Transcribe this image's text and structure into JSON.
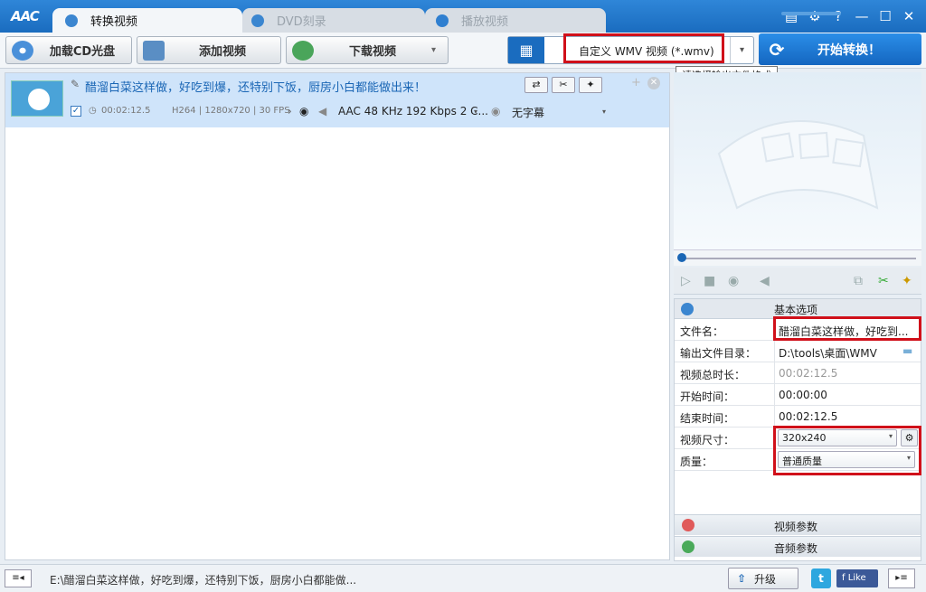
{
  "app": {
    "logo": "AAC"
  },
  "tabs": [
    {
      "label": "转换视频",
      "active": true
    },
    {
      "label": "DVD刻录",
      "active": false
    },
    {
      "label": "播放视频",
      "active": false
    }
  ],
  "window_controls": {
    "menu": "▤",
    "settings": "⚙",
    "help": "?",
    "minimize": "—",
    "maximize": "☐",
    "close": "✕"
  },
  "toolbar": {
    "load_cd": "加载CD光盘",
    "add_video": "添加视频",
    "download_video": "下载视频",
    "download_arrow": "▾"
  },
  "format": {
    "value": "自定义 WMV 视频 (*.wmv)",
    "tooltip": "请选择输出文件格式",
    "arrow": "▾",
    "film_icon": "▦"
  },
  "start": {
    "label": "开始转换！",
    "icon": "⟳"
  },
  "item": {
    "title": "醋溜白菜这样做，好吃到爆，还特别下饭，厨房小白都能做出来！",
    "duration": "00:02:12.5",
    "codec": "H264 | 1280x720 | 30 FPS",
    "audio": "AAC 48 KHz 192 Kbps 2 C...",
    "subtitle": "无字幕",
    "checkbox": "✓",
    "pencil": "✎",
    "btn_convert": "⇄",
    "btn_cut": "✂",
    "btn_effect": "✦",
    "plus": "+",
    "close": "✕",
    "dd": "▾",
    "arrow_right": "›"
  },
  "player": {
    "play": "▷",
    "stop": "■",
    "snapshot": "◉",
    "volume": "◀",
    "clip": "⧉",
    "cut": "✂",
    "magic": "✦"
  },
  "props": {
    "section_basic": "基本选项",
    "rows": [
      {
        "key": "文件名：",
        "value": "醋溜白菜这样做，好吃到..."
      },
      {
        "key": "输出文件目录：",
        "value": "D:\\tools\\桌面\\WMV"
      },
      {
        "key": "视频总时长：",
        "value": "00:02:12.5"
      },
      {
        "key": "开始时间：",
        "value": "00:00:00"
      },
      {
        "key": "结束时间：",
        "value": "00:02:12.5"
      },
      {
        "key": "视频尺寸：",
        "value": "320x240"
      },
      {
        "key": "质量：",
        "value": "普通质量"
      }
    ],
    "video_params": "视频参数",
    "audio_params": "音频参数",
    "folder_icon": "▬",
    "gear": "⚙",
    "dd": "▾"
  },
  "status": {
    "path": "E:\\醋溜白菜这样做，好吃到爆，还特别下饭，厨房小白都能做...",
    "upgrade": "升级",
    "upgrade_icon": "⇧",
    "twitter": "t",
    "facebook": "f Like",
    "left_icon": "≡◂",
    "right_icon": "▸≡"
  },
  "colors": {
    "accent": "#1a6cbf",
    "highlight": "#d0101a",
    "selected_row": "#cfe4fa"
  }
}
